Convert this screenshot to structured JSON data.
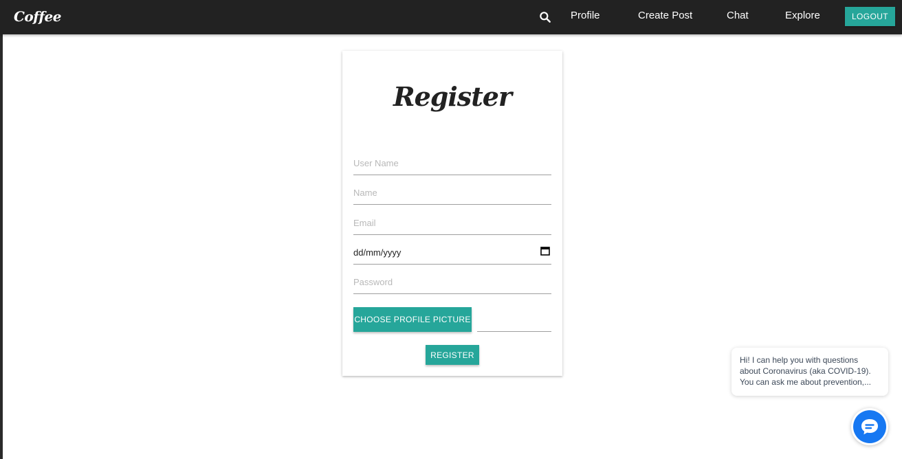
{
  "navbar": {
    "brand": "Coffee",
    "search_icon": "search-icon",
    "links": [
      "Profile",
      "Create Post",
      "Chat",
      "Explore"
    ],
    "logout_label": "Logout"
  },
  "form": {
    "title": "Register",
    "fields": {
      "username_placeholder": "User Name",
      "name_placeholder": "Name",
      "email_placeholder": "Email",
      "date_placeholder": "dd/mm/yyyy",
      "password_placeholder": "Password"
    },
    "calendar_icon": "calendar-icon",
    "choose_picture_label": "Choose Profile Picture",
    "register_label": "Register"
  },
  "chat_widget": {
    "message": "Hi! I can help you with questions about Coronavirus (aka COVID-19). You can ask me about prevention,...",
    "button_icon": "chat-bubble-icon"
  },
  "colors": {
    "accent": "#26a69a",
    "navbar": "#222222",
    "chat_blue": "#1778f2"
  }
}
